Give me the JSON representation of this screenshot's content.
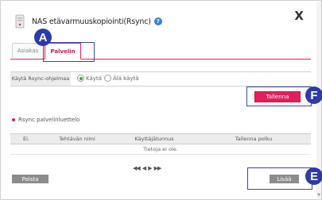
{
  "window": {
    "title": "NAS etävarmuuskopiointi(Rsync)",
    "help_icon": "question-circle-icon",
    "close_label": "X"
  },
  "tabs": [
    {
      "label": "Asiakas",
      "active": false
    },
    {
      "label": "Palvelin",
      "active": true
    }
  ],
  "settings": {
    "rsync_service_label": "Käytä Rsync-ohjelmaa",
    "options": [
      {
        "label": "Käytä",
        "selected": true
      },
      {
        "label": "Älä käytä",
        "selected": false
      }
    ],
    "save_label": "Tallenna"
  },
  "server_list": {
    "title": "Rsync palvelinluettelo",
    "columns": [
      "Ei.",
      "Tehtävän nimi",
      "Käyttäjätunnus",
      "Tallenna polku"
    ],
    "empty_message": "Tietoja ei ole.",
    "pager_first": "◀◀",
    "pager_prev": "◀",
    "pager_next": "▶",
    "pager_last": "▶▶"
  },
  "actions": {
    "delete_label": "Poista",
    "add_label": "Lisää"
  },
  "annotations": {
    "a": "A",
    "f": "F",
    "e": "E"
  },
  "colors": {
    "accent": "#e1215a",
    "marker": "#2d3aa8",
    "button_gray": "#8c8c8c"
  }
}
